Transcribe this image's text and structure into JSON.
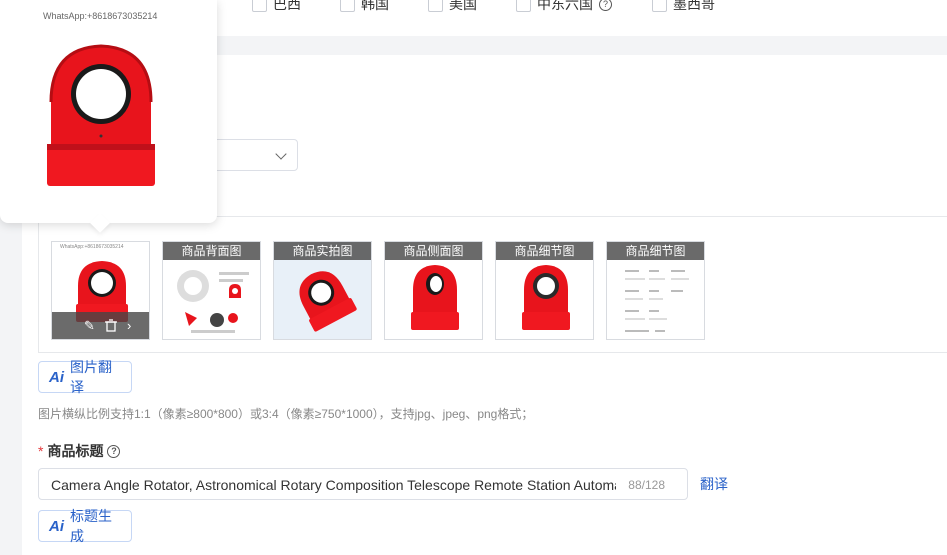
{
  "countries": [
    {
      "name": "巴西",
      "checked": false
    },
    {
      "name": "韩国",
      "checked": false
    },
    {
      "name": "美国",
      "checked": false
    },
    {
      "name": "中东六国",
      "checked": false,
      "help": "?"
    },
    {
      "name": "墨西哥",
      "checked": false
    }
  ],
  "popover": {
    "watermark": "WhatsApp:+8618673035214"
  },
  "thumbnails": {
    "main_watermark": "WhatsApp:+8618673035214",
    "labels": [
      "商品背面图",
      "商品实拍图",
      "商品侧面图",
      "商品细节图",
      "商品细节图"
    ]
  },
  "buttons": {
    "image_translate": "图片翻译",
    "title_generate": "标题生成",
    "ai": "Ai"
  },
  "hint": "图片横纵比例支持1:1（像素≥800*800）或3:4（像素≥750*1000），支持jpg、jpeg、png格式；",
  "title_field": {
    "required_mark": "*",
    "label": "商品标题",
    "help": "?",
    "value": "Camera Angle Rotator, Astronomical Rotary Composition Telescope Remote Station Automatic",
    "count": "88/128",
    "translate": "翻译"
  },
  "colors": {
    "accent": "#2a62c9",
    "product_red": "#e8141c",
    "required": "#e4393c"
  }
}
